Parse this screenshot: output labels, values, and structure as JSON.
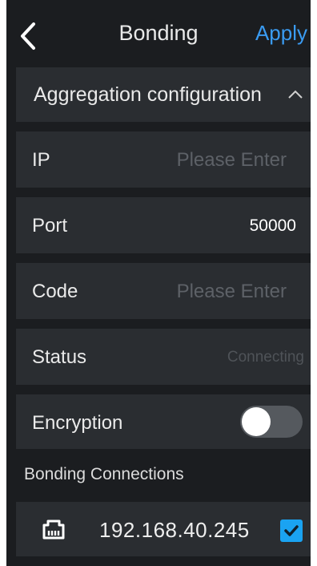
{
  "header": {
    "title": "Bonding",
    "apply_label": "Apply"
  },
  "section": {
    "title": "Aggregation configuration"
  },
  "fields": {
    "ip": {
      "label": "IP",
      "placeholder": "Please Enter"
    },
    "port": {
      "label": "Port",
      "value": "50000"
    },
    "code": {
      "label": "Code",
      "placeholder": "Please Enter"
    },
    "status": {
      "label": "Status",
      "value": "Connecting"
    },
    "encryption": {
      "label": "Encryption",
      "enabled": false
    }
  },
  "connections": {
    "title": "Bonding Connections",
    "items": [
      {
        "ip": "192.168.40.245",
        "checked": true,
        "icon": "ethernet-icon"
      }
    ]
  },
  "colors": {
    "accent": "#3a9bf2",
    "checkbox": "#1aa3f2",
    "panel": "#2a2d31",
    "background": "#1b1d20"
  }
}
